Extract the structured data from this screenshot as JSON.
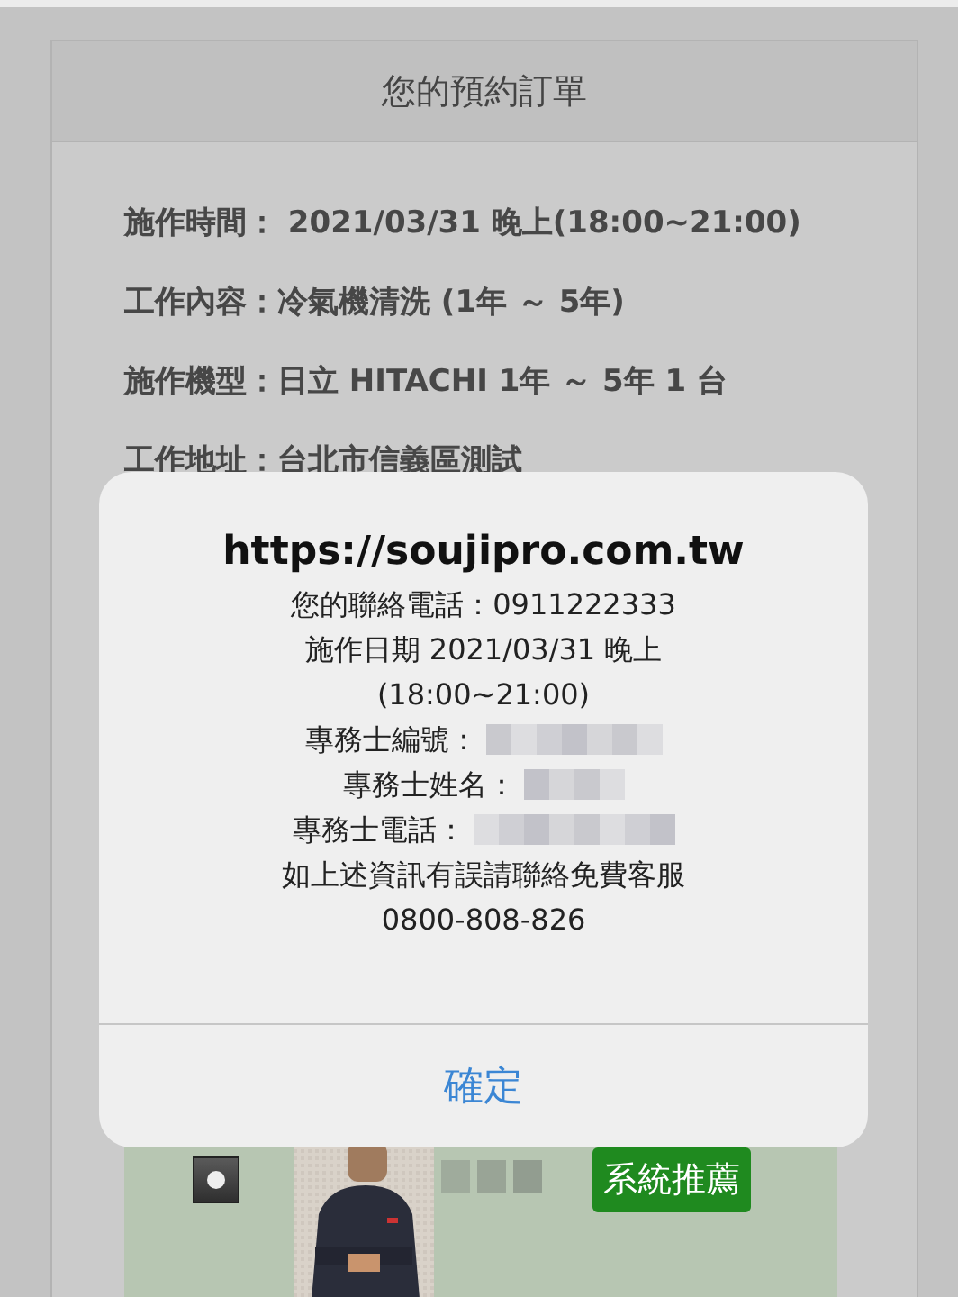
{
  "order": {
    "title": "您的預約訂單",
    "details": [
      "施作時間： 2021/03/31 晚上(18:00~21:00)",
      "工作內容：冷氣機清洗 (1年 ～ 5年)",
      "施作機型：日立 HITACHI 1年 ～ 5年 1 台",
      "工作地址：台北市信義區測試"
    ]
  },
  "technician": {
    "selected": true,
    "badge": "系統推薦"
  },
  "alert": {
    "title": "https://soujipro.com.tw",
    "lines": [
      {
        "text": "您的聯絡電話：0911222333",
        "redacted": false
      },
      {
        "text": "施作日期 2021/03/31 晚上",
        "redacted": false
      },
      {
        "text": "(18:00~21:00)",
        "redacted": false
      },
      {
        "text": "專務士編號：",
        "redacted": true
      },
      {
        "text": "專務士姓名：",
        "redacted": true
      },
      {
        "text": "專務士電話：",
        "redacted": true
      },
      {
        "text": "如上述資訊有誤請聯絡免費客服",
        "redacted": false
      },
      {
        "text": "0800-808-826",
        "redacted": false
      }
    ],
    "button": "確定"
  }
}
